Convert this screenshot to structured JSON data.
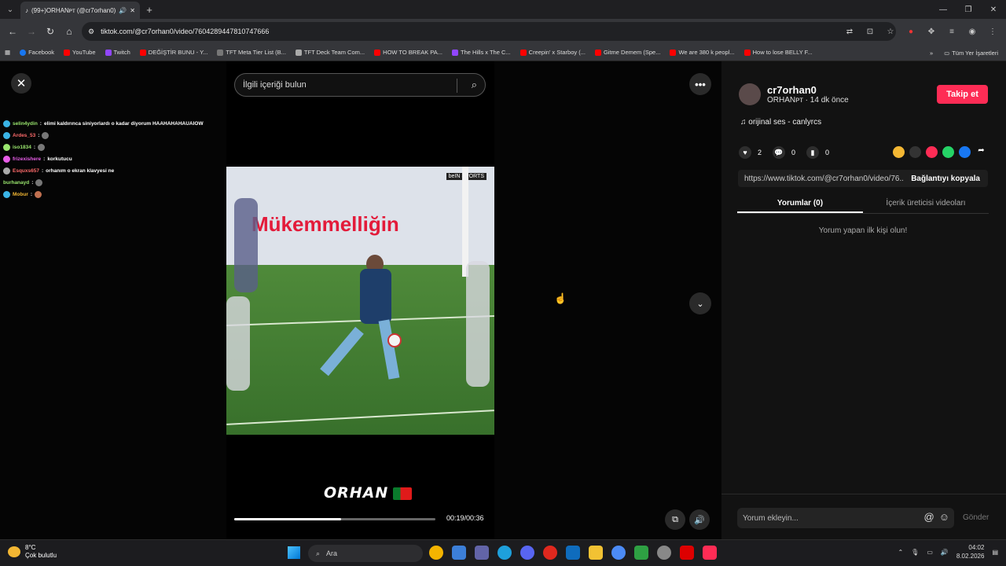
{
  "browser": {
    "tab_title": "(99+)ORHANᴘᴛ (@cr7orhan0)",
    "url": "tiktok.com/@cr7orhan0/video/7604289447810747666",
    "bookmarks": [
      "Facebook",
      "YouTube",
      "Twitch",
      "DEĞİŞTİR BUNU - Y...",
      "TFT Meta Tier List (B...",
      "TFT Deck Team Com...",
      "HOW TO BREAK PA...",
      "The Hills x The C...",
      "Creepin' x Starboy (...",
      "Gitme Demem (Spe...",
      "We are 380 k peopl...",
      "How to lose BELLY F..."
    ],
    "bookmarks_all": "Tüm Yer İşaretleri"
  },
  "chat": [
    {
      "user": "selin4ydin",
      "msg": "elimi kaldırınca siniyorlardı o kadar diyorum HAAHAHAHAUAIOW",
      "color": "#9ae66e"
    },
    {
      "user": "Ardes_53",
      "msg": "",
      "color": "#ff6b6b"
    },
    {
      "user": "iso1834",
      "msg": "",
      "color": "#9ae66e"
    },
    {
      "user": "frizexishere",
      "msg": "korkutucu",
      "color": "#e85de8"
    },
    {
      "user": "Esquxs657",
      "msg": "orhanım o ekran klavyesi ne",
      "color": "#ff6b6b"
    },
    {
      "user": "burhanayd",
      "msg": "",
      "color": "#9ae66e"
    },
    {
      "user": "Mobur",
      "msg": "",
      "color": "#f3b733"
    }
  ],
  "video": {
    "search_placeholder": "İlgili içeriği bulun",
    "banner_text": "Mükemmelliğin",
    "channel_badge": "beIN SPORTS",
    "overlay_name": "ORHAN",
    "time": "00:19/00:36",
    "progress_fraction": 0.53
  },
  "side": {
    "username": "cr7orhan0",
    "subline": "ORHANᴘᴛ · 14 dk önce",
    "follow": "Takip et",
    "music": "♫  orijinal ses - canlyrcs",
    "likes": "2",
    "comments": "0",
    "saves": "0",
    "link": "https://www.tiktok.com/@cr7orhan0/video/76...",
    "copy": "Bağlantıyı kopyala",
    "tab_comments": "Yorumlar (0)",
    "tab_creator": "İçerik üreticisi videoları",
    "empty": "Yorum yapan ilk kişi olun!",
    "comment_placeholder": "Yorum ekleyin...",
    "send": "Gönder"
  },
  "taskbar": {
    "temp": "8°C",
    "weather": "Çok bulutlu",
    "search": "Ara",
    "time": "04:02",
    "date": "8.02.2026"
  }
}
